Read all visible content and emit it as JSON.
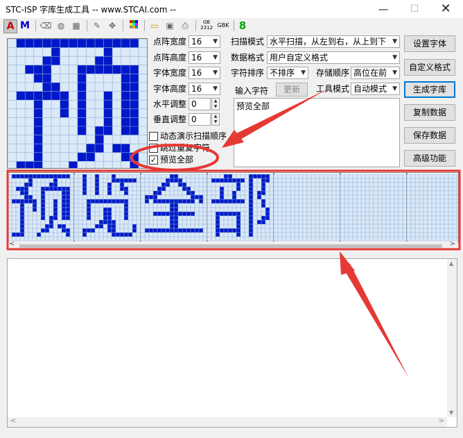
{
  "window": {
    "title": "STC-ISP 字库生成工具 -- www.STCAI.com --",
    "minimize_icon": "minimize-icon",
    "maximize_icon": "maximize-icon",
    "close_icon": "close-icon"
  },
  "toolbar": {
    "items": [
      {
        "label": "A",
        "icon": "font-a-icon",
        "color": "#cc0000"
      },
      {
        "label": "M",
        "icon": "font-m-icon",
        "color": "#0000cc"
      },
      {
        "label": "",
        "icon": "eraser-icon"
      },
      {
        "label": "",
        "icon": "fill-icon"
      },
      {
        "label": "",
        "icon": "stamp-icon"
      },
      {
        "label": "",
        "icon": "pencil-icon"
      },
      {
        "label": "",
        "icon": "move-icon"
      },
      {
        "label": "",
        "icon": "open-folder-icon"
      },
      {
        "label": "",
        "icon": "save-icon"
      },
      {
        "label": "",
        "icon": "print-icon"
      },
      {
        "label": "GB 2312",
        "icon": "gb2312-icon"
      },
      {
        "label": "GBK",
        "icon": "gbk-icon"
      },
      {
        "label": "8",
        "icon": "digit-8-icon",
        "color": "#00aa00"
      }
    ]
  },
  "settings": {
    "dot_width": {
      "label": "点阵宽度",
      "value": "16"
    },
    "dot_height": {
      "label": "点阵高度",
      "value": "16"
    },
    "font_width": {
      "label": "字体宽度",
      "value": "16"
    },
    "font_height": {
      "label": "字体高度",
      "value": "16"
    },
    "h_adjust": {
      "label": "水平调整",
      "value": "0"
    },
    "v_adjust": {
      "label": "垂直调整",
      "value": "0"
    },
    "scan_mode": {
      "label": "扫描模式",
      "value": "水平扫描，从左到右，从上到下"
    },
    "data_format": {
      "label": "数据格式",
      "value": "用户自定义格式"
    },
    "char_sort": {
      "label": "字符排序",
      "value": "不排序"
    },
    "storage_order": {
      "label": "存储顺序",
      "value": "高位在前"
    },
    "input_char": {
      "label": "输入字符",
      "value": "预览全部"
    },
    "update_button": "更新",
    "tool_mode": {
      "label": "工具模式",
      "value": "自动模式"
    }
  },
  "checkboxes": [
    {
      "label": "动态演示扫描顺序",
      "checked": false
    },
    {
      "label": "跳过重复字符",
      "checked": false
    },
    {
      "label": "预览全部",
      "checked": true
    }
  ],
  "buttons": {
    "set_font": "设置字体",
    "custom_format": "自定义格式",
    "generate": "生成字库",
    "copy_data": "复制数据",
    "save_data": "保存数据",
    "advanced": "高级功能"
  },
  "preview_chars": [
    "预",
    "览",
    "全",
    "部"
  ],
  "colors": {
    "pixel_on": "#0018c8",
    "grid_bg": "#dbe9f8",
    "grid_line": "#8fb0d8",
    "annotation": "#e53935"
  }
}
